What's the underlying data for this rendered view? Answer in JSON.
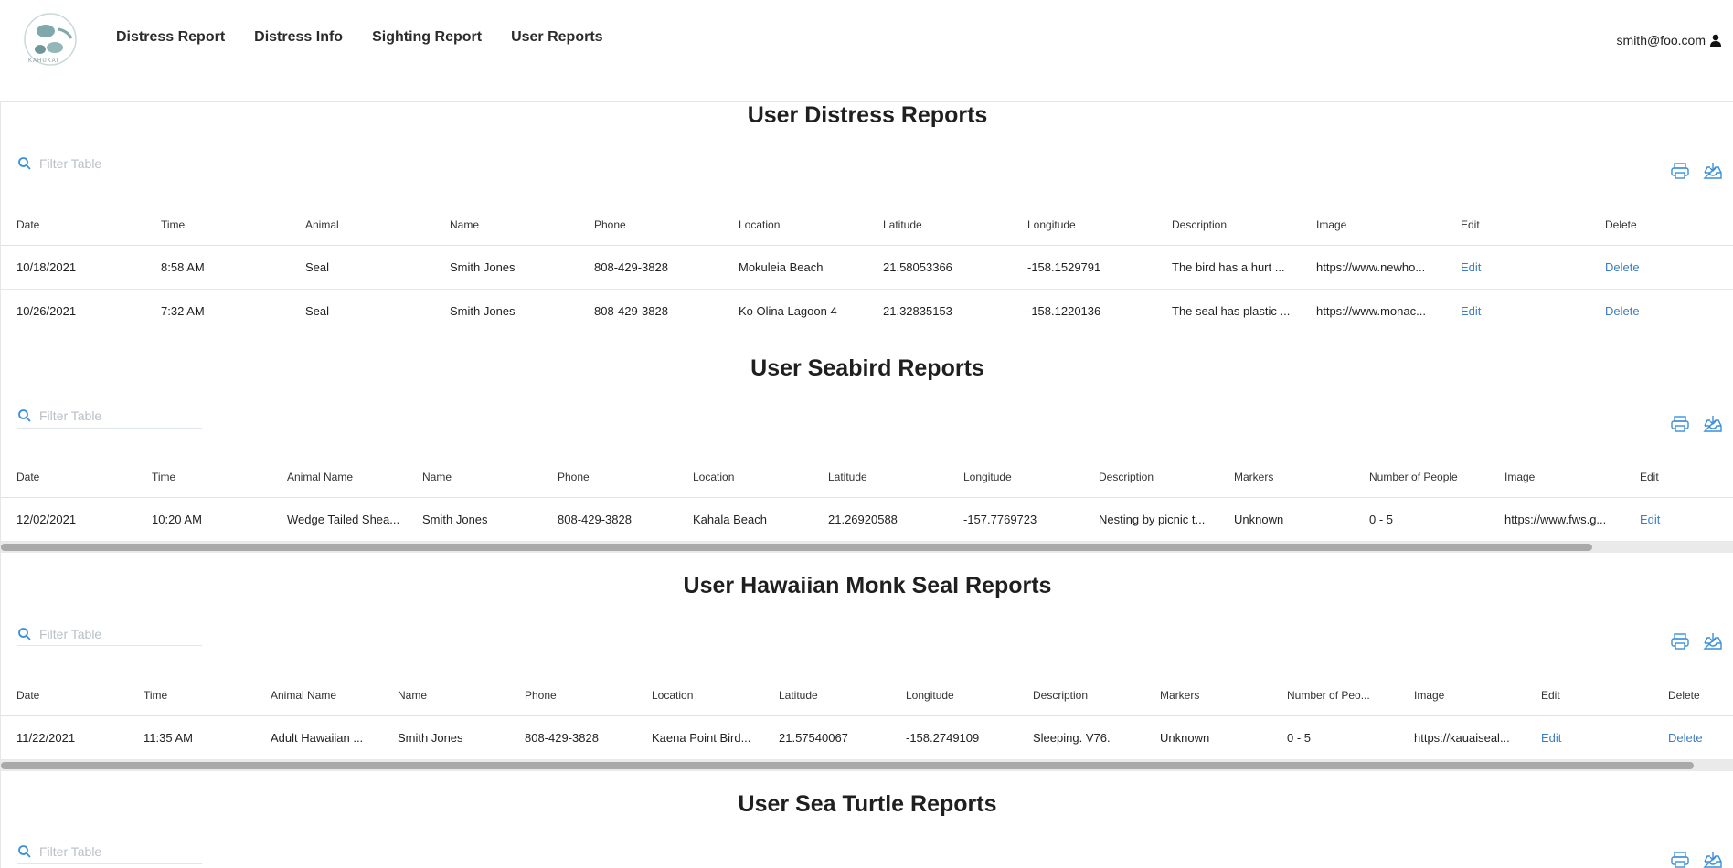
{
  "header": {
    "brand": "KAHUKAI",
    "nav": [
      "Distress Report",
      "Distress Info",
      "Sighting Report",
      "User Reports"
    ],
    "user_email": "smith@foo.com"
  },
  "colors": {
    "link": "#3b7dc5",
    "icon_blue": "#3b8fd9",
    "logo_teal": "#7fa9ab"
  },
  "filter_placeholder": "Filter Table",
  "icons": {
    "search": "search-icon",
    "print": "printer-icon",
    "export": "download-tray-icon",
    "user": "user-icon"
  },
  "distress": {
    "title": "User Distress Reports",
    "headers": [
      "Date",
      "Time",
      "Animal",
      "Name",
      "Phone",
      "Location",
      "Latitude",
      "Longitude",
      "Description",
      "Image",
      "Edit",
      "Delete"
    ],
    "rows": [
      [
        "10/18/2021",
        "8:58 AM",
        "Seal",
        "Smith Jones",
        "808-429-3828",
        "Mokuleia Beach",
        "21.58053366",
        "-158.1529791",
        "The bird has a hurt ...",
        "https://www.newho...",
        "Edit",
        "Delete"
      ],
      [
        "10/26/2021",
        "7:32 AM",
        "Seal",
        "Smith Jones",
        "808-429-3828",
        "Ko Olina Lagoon 4",
        "21.32835153",
        "-158.1220136",
        "The seal has plastic ...",
        "https://www.monac...",
        "Edit",
        "Delete"
      ]
    ]
  },
  "seabird": {
    "title": "User Seabird Reports",
    "headers": [
      "Date",
      "Time",
      "Animal Name",
      "Name",
      "Phone",
      "Location",
      "Latitude",
      "Longitude",
      "Description",
      "Markers",
      "Number of People",
      "Image",
      "Edit"
    ],
    "rows": [
      [
        "12/02/2021",
        "10:20 AM",
        "Wedge Tailed Shea...",
        "Smith Jones",
        "808-429-3828",
        "Kahala Beach",
        "21.26920588",
        "-157.7769723",
        "Nesting by picnic t...",
        "Unknown",
        "0 - 5",
        "https://www.fws.g...",
        "Edit"
      ]
    ],
    "scroll_fraction": 0.918
  },
  "monkseal": {
    "title": "User Hawaiian Monk Seal Reports",
    "headers": [
      "Date",
      "Time",
      "Animal Name",
      "Name",
      "Phone",
      "Location",
      "Latitude",
      "Longitude",
      "Description",
      "Markers",
      "Number of Peo...",
      "Image",
      "Edit",
      "Delete"
    ],
    "rows": [
      [
        "11/22/2021",
        "11:35 AM",
        "Adult Hawaiian ...",
        "Smith Jones",
        "808-429-3828",
        "Kaena Point Bird...",
        "21.57540067",
        "-158.2749109",
        "Sleeping. V76.",
        "Unknown",
        "0 - 5",
        "https://kauaiseal...",
        "Edit",
        "Delete"
      ]
    ],
    "scroll_fraction": 0.977
  },
  "turtle": {
    "title": "User Sea Turtle Reports"
  }
}
